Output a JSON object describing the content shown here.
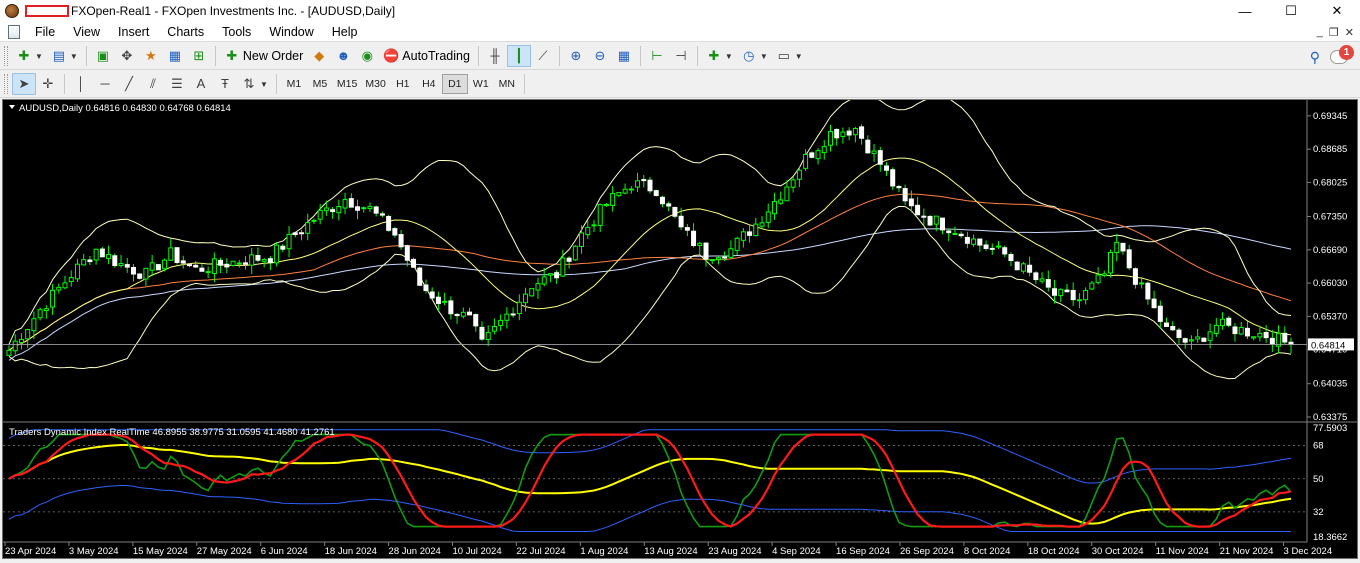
{
  "window": {
    "title": "FXOpen-Real1 - FXOpen Investments Inc. - [AUDUSD,Daily]",
    "controls": {
      "minimize": "—",
      "maximize": "☐",
      "close": "✕"
    }
  },
  "menu": {
    "items": [
      "File",
      "View",
      "Insert",
      "Charts",
      "Tools",
      "Window",
      "Help"
    ],
    "mdi": {
      "minimize": "_",
      "restore": "❐",
      "close": "✕"
    }
  },
  "toolbar": {
    "new_order_label": "New Order",
    "autotrading_label": "AutoTrading",
    "notification_count": "1"
  },
  "timeframes": {
    "items": [
      "M1",
      "M5",
      "M15",
      "M30",
      "H1",
      "H4",
      "D1",
      "W1",
      "MN"
    ],
    "active": "D1"
  },
  "chart": {
    "header": "AUDUSD,Daily  0.64816 0.64830 0.64768 0.64814",
    "price_ticks": [
      "0.69345",
      "0.68685",
      "0.68025",
      "0.67350",
      "0.66690",
      "0.66030",
      "0.65370",
      "0.64710",
      "0.64035",
      "0.63375"
    ],
    "current_price": "0.64814",
    "indicator_header": "Traders Dynamic Index RealTime 46.8955 38.9775 31.0595 41.4680 41.2761",
    "indicator_ticks": [
      "77.5903",
      "68",
      "50",
      "32",
      "18.3662"
    ],
    "date_ticks": [
      "23 Apr 2024",
      "3 May 2024",
      "15 May 2024",
      "27 May 2024",
      "6 Jun 2024",
      "18 Jun 2024",
      "28 Jun 2024",
      "10 Jul 2024",
      "22 Jul 2024",
      "1 Aug 2024",
      "13 Aug 2024",
      "23 Aug 2024",
      "4 Sep 2024",
      "16 Sep 2024",
      "26 Sep 2024",
      "8 Oct 2024",
      "18 Oct 2024",
      "30 Oct 2024",
      "11 Nov 2024",
      "21 Nov 2024",
      "3 Dec 2024"
    ],
    "colors": {
      "background": "#000000",
      "bull": "#00ff00",
      "bear": "#ffffff",
      "bollinger": "#ffffc0",
      "ma_slow": "#c8d8ff",
      "ma_mid": "#ff8040",
      "ma_fast": "#ffff80",
      "tdi_green": "#0f9d0f",
      "tdi_red": "#ff1a1a",
      "tdi_yellow": "#ffff00",
      "tdi_band": "#3060ff",
      "text": "#ffffff",
      "level": "#808080"
    }
  },
  "chart_data": {
    "type": "candlestick",
    "symbol": "AUDUSD",
    "timeframe": "Daily",
    "ylim": [
      0.63375,
      0.696
    ],
    "anchors": [
      [
        0,
        0.647
      ],
      [
        5,
        0.655
      ],
      [
        10,
        0.662
      ],
      [
        14,
        0.667
      ],
      [
        18,
        0.664
      ],
      [
        22,
        0.662
      ],
      [
        26,
        0.666
      ],
      [
        30,
        0.663
      ],
      [
        34,
        0.664
      ],
      [
        38,
        0.665
      ],
      [
        42,
        0.6655
      ],
      [
        46,
        0.67
      ],
      [
        50,
        0.674
      ],
      [
        54,
        0.677
      ],
      [
        58,
        0.675
      ],
      [
        62,
        0.67
      ],
      [
        66,
        0.66
      ],
      [
        70,
        0.656
      ],
      [
        74,
        0.653
      ],
      [
        76,
        0.648
      ],
      [
        80,
        0.654
      ],
      [
        84,
        0.66
      ],
      [
        88,
        0.662
      ],
      [
        92,
        0.67
      ],
      [
        96,
        0.676
      ],
      [
        100,
        0.68
      ],
      [
        104,
        0.679
      ],
      [
        108,
        0.671
      ],
      [
        112,
        0.666
      ],
      [
        116,
        0.667
      ],
      [
        120,
        0.672
      ],
      [
        124,
        0.678
      ],
      [
        128,
        0.685
      ],
      [
        132,
        0.69
      ],
      [
        136,
        0.691
      ],
      [
        140,
        0.684
      ],
      [
        144,
        0.676
      ],
      [
        148,
        0.673
      ],
      [
        152,
        0.671
      ],
      [
        156,
        0.668
      ],
      [
        160,
        0.666
      ],
      [
        164,
        0.662
      ],
      [
        168,
        0.658
      ],
      [
        172,
        0.657
      ],
      [
        176,
        0.662
      ],
      [
        178,
        0.668
      ],
      [
        182,
        0.659
      ],
      [
        186,
        0.651
      ],
      [
        190,
        0.648
      ],
      [
        194,
        0.652
      ],
      [
        198,
        0.651
      ],
      [
        202,
        0.65
      ],
      [
        206,
        0.6481
      ]
    ],
    "tdi_levels": [
      68,
      50,
      32
    ],
    "tdi_ylim": [
      18.3662,
      77.5903
    ]
  }
}
